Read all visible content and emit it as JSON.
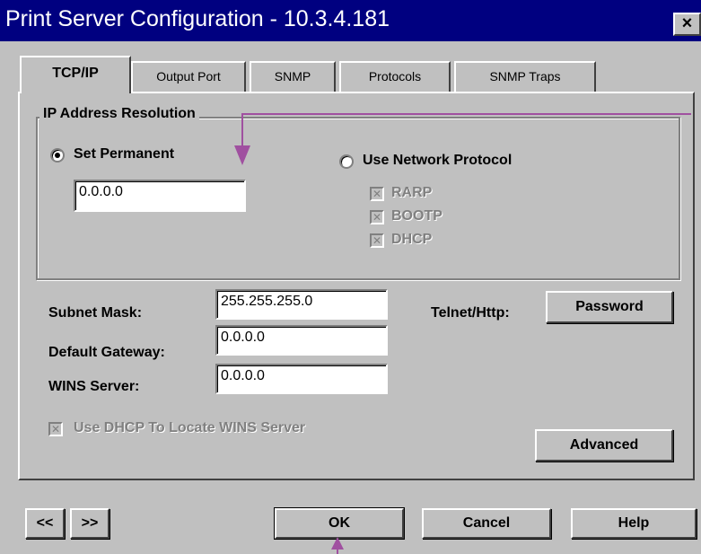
{
  "window": {
    "title": "Print Server Configuration - 10.3.4.181",
    "close_label": "×"
  },
  "tabs": [
    {
      "label": "TCP/IP",
      "active": true
    },
    {
      "label": "Output Port",
      "active": false
    },
    {
      "label": "SNMP",
      "active": false
    },
    {
      "label": "Protocols",
      "active": false
    },
    {
      "label": "SNMP Traps",
      "active": false
    }
  ],
  "ip_resolution": {
    "group_label": "IP Address Resolution",
    "set_permanent_label": "Set Permanent",
    "set_permanent_selected": true,
    "ip_value": "0.0.0.0",
    "use_network_label": "Use Network Protocol",
    "use_network_selected": false,
    "protocols": [
      {
        "label": "RARP",
        "checked": true,
        "disabled": true
      },
      {
        "label": "BOOTP",
        "checked": true,
        "disabled": true
      },
      {
        "label": "DHCP",
        "checked": true,
        "disabled": true
      }
    ]
  },
  "fields": {
    "subnet_label": "Subnet Mask:",
    "subnet_value": "255.255.255.0",
    "gateway_label": "Default Gateway:",
    "gateway_value": "0.0.0.0",
    "wins_label": "WINS Server:",
    "wins_value": "0.0.0.0",
    "dhcp_wins_label": "Use DHCP To Locate WINS Server",
    "dhcp_wins_checked": true
  },
  "telnet": {
    "label": "Telnet/Http:",
    "password_button": "Password"
  },
  "buttons": {
    "advanced": "Advanced",
    "prev": "<<",
    "next": ">>",
    "ok": "OK",
    "cancel": "Cancel",
    "help": "Help"
  },
  "colors": {
    "titlebar": "#000080",
    "face": "#c0c0c0",
    "callout": "#a050a0"
  }
}
